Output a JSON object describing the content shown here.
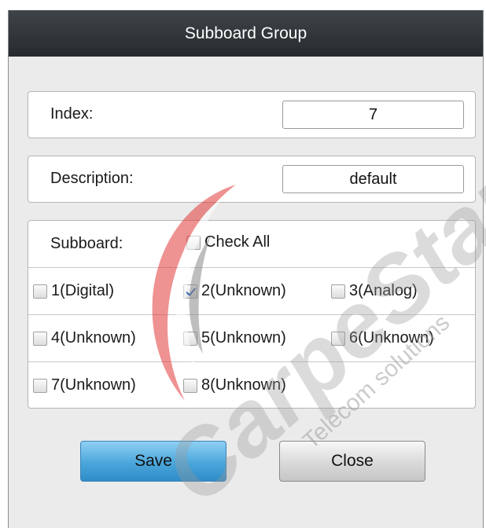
{
  "dialog": {
    "title": "Subboard Group"
  },
  "index": {
    "label": "Index:",
    "value": "7"
  },
  "description": {
    "label": "Description:",
    "value": "default"
  },
  "subboard": {
    "label": "Subboard:",
    "check_all": {
      "label": "Check All",
      "checked": false
    },
    "items": [
      {
        "label": "1(Digital)",
        "checked": false
      },
      {
        "label": "2(Unknown)",
        "checked": true
      },
      {
        "label": "3(Analog)",
        "checked": false
      },
      {
        "label": "4(Unknown)",
        "checked": false
      },
      {
        "label": "5(Unknown)",
        "checked": false
      },
      {
        "label": "6(Unknown)",
        "checked": false
      },
      {
        "label": "7(Unknown)",
        "checked": false
      },
      {
        "label": "8(Unknown)",
        "checked": false
      }
    ]
  },
  "buttons": {
    "save": "Save",
    "close": "Close"
  },
  "watermark": {
    "brand": "CarpeStar",
    "tagline": "Telecom solutions"
  }
}
